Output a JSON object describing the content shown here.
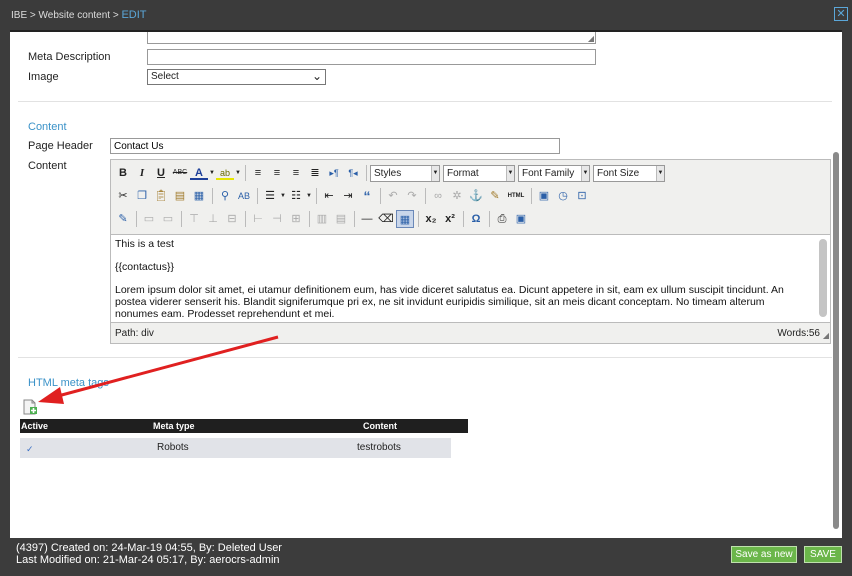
{
  "header": {
    "crumb_1": "IBE",
    "crumb_sep_1": " > ",
    "crumb_2": "Website content",
    "crumb_sep_2": " > ",
    "crumb_current": "EDIT",
    "close_glyph": "✕"
  },
  "form": {
    "meta_description_label": "Meta Description",
    "meta_description_value": "",
    "image_label": "Image",
    "image_selected": "Select",
    "content_section_title": "Content",
    "page_header_label": "Page Header",
    "page_header_value": "Contact Us",
    "content_label": "Content"
  },
  "editor": {
    "toolbar": {
      "bold": "B",
      "italic": "I",
      "underline": "U",
      "strikethrough": "ABC",
      "styles": "Styles",
      "format": "Format",
      "font_family": "Font Family",
      "font_size": "Font Size",
      "html": "HTML"
    },
    "paragraphs": [
      "This is a test",
      "{{contactus}}",
      "Lorem ipsum dolor sit amet, ei utamur definitionem eum, has vide diceret salutatus ea. Dicunt appetere in sit, eam ex ullum suscipit tincidunt. An postea viderer senserit his. Blandit signiferumque pri ex, ne sit invidunt euripidis similique, sit an meis dicant conceptam. No timeam alterum nonumes eam. Prodesset reprehendunt et mei."
    ],
    "path": "Path: div",
    "words": "Words:56"
  },
  "meta_tags": {
    "section_title": "HTML meta tags",
    "columns": [
      "Active",
      "Meta type",
      "Content"
    ],
    "rows": [
      {
        "active": "✓",
        "meta_type": "Robots",
        "content": "testrobots"
      }
    ]
  },
  "footer": {
    "created": "(4397) Created on: 24-Mar-19 04:55, By: Deleted User",
    "modified": "Last Modified on: 21-Mar-24 05:17, By: aerocrs-admin",
    "save_as_new": "Save as new",
    "save": "SAVE"
  },
  "colors": {
    "accent_blue": "#3a92c8",
    "button_green": "#6bb64a",
    "annotation_arrow": "#e02020"
  }
}
